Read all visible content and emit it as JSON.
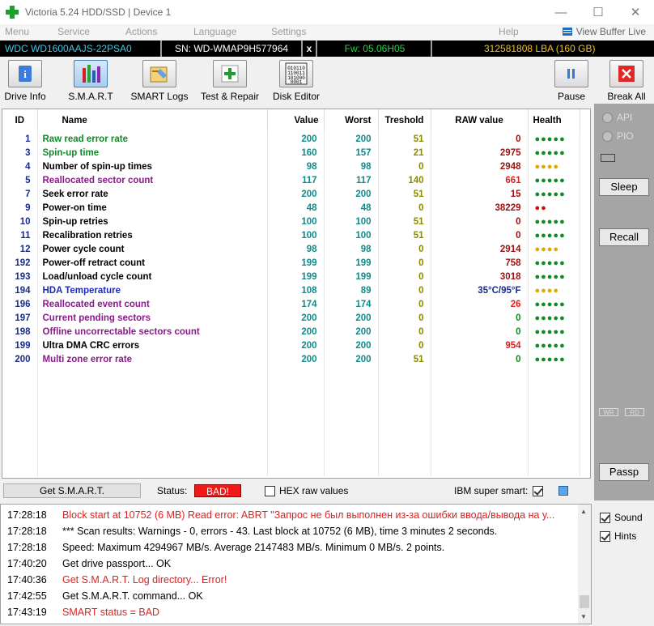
{
  "window": {
    "title": "Victoria 5.24 HDD/SSD | Device 1",
    "minimize": "—",
    "maximize": "☐",
    "close": "✕"
  },
  "menu": {
    "items": [
      "Menu",
      "Service",
      "Actions",
      "Language",
      "Settings",
      "Help"
    ],
    "view_buffer": "View Buffer Live"
  },
  "device": {
    "model": "WDC WD1600AAJS-22PSA0",
    "serial": "SN: WD-WMAP9H577964",
    "close_mark": "x",
    "firmware": "Fw: 05.06H05",
    "lba": "312581808 LBA (160 GB)"
  },
  "toolbar": {
    "drive_info": "Drive Info",
    "smart": "S.M.A.R.T",
    "smart_logs": "SMART Logs",
    "test_repair": "Test & Repair",
    "disk_editor": "Disk Editor",
    "pause": "Pause",
    "break_all": "Break All"
  },
  "table": {
    "headers": {
      "id": "ID",
      "name": "Name",
      "value": "Value",
      "worst": "Worst",
      "threshold": "Treshold",
      "raw": "RAW value",
      "health": "Health"
    },
    "rows": [
      {
        "id": "1",
        "name": "Raw read error rate",
        "value": "200",
        "worst": "200",
        "threshold": "51",
        "raw": "0",
        "health": "●●●●●",
        "name_color": "#0f8a25",
        "health_color": "#0f8a25",
        "raw_color": "#9b1010"
      },
      {
        "id": "3",
        "name": "Spin-up time",
        "value": "160",
        "worst": "157",
        "threshold": "21",
        "raw": "2975",
        "health": "●●●●●",
        "name_color": "#0f8a25",
        "health_color": "#0f8a25",
        "raw_color": "#9b1010"
      },
      {
        "id": "4",
        "name": "Number of spin-up times",
        "value": "98",
        "worst": "98",
        "threshold": "0",
        "raw": "2948",
        "health": "●●●●",
        "name_color": "#000000",
        "health_color": "#e0a800",
        "raw_color": "#9b1010"
      },
      {
        "id": "5",
        "name": "Reallocated sector count",
        "value": "117",
        "worst": "117",
        "threshold": "140",
        "raw": "661",
        "health": "●●●●●",
        "name_color": "#8b1a8b",
        "health_color": "#0f8a25",
        "raw_color": "#e02020"
      },
      {
        "id": "7",
        "name": "Seek error rate",
        "value": "200",
        "worst": "200",
        "threshold": "51",
        "raw": "15",
        "health": "●●●●●",
        "name_color": "#000000",
        "health_color": "#0f8a25",
        "raw_color": "#9b1010"
      },
      {
        "id": "9",
        "name": "Power-on time",
        "value": "48",
        "worst": "48",
        "threshold": "0",
        "raw": "38229",
        "health": "●●",
        "name_color": "#000000",
        "health_color": "#d01010",
        "raw_color": "#9b1010"
      },
      {
        "id": "10",
        "name": "Spin-up retries",
        "value": "100",
        "worst": "100",
        "threshold": "51",
        "raw": "0",
        "health": "●●●●●",
        "name_color": "#000000",
        "health_color": "#0f8a25",
        "raw_color": "#9b1010"
      },
      {
        "id": "11",
        "name": "Recalibration retries",
        "value": "100",
        "worst": "100",
        "threshold": "51",
        "raw": "0",
        "health": "●●●●●",
        "name_color": "#000000",
        "health_color": "#0f8a25",
        "raw_color": "#9b1010"
      },
      {
        "id": "12",
        "name": "Power cycle count",
        "value": "98",
        "worst": "98",
        "threshold": "0",
        "raw": "2914",
        "health": "●●●●",
        "name_color": "#000000",
        "health_color": "#e0a800",
        "raw_color": "#9b1010"
      },
      {
        "id": "192",
        "name": "Power-off retract count",
        "value": "199",
        "worst": "199",
        "threshold": "0",
        "raw": "758",
        "health": "●●●●●",
        "name_color": "#000000",
        "health_color": "#0f8a25",
        "raw_color": "#9b1010"
      },
      {
        "id": "193",
        "name": "Load/unload cycle count",
        "value": "199",
        "worst": "199",
        "threshold": "0",
        "raw": "3018",
        "health": "●●●●●",
        "name_color": "#000000",
        "health_color": "#0f8a25",
        "raw_color": "#9b1010"
      },
      {
        "id": "194",
        "name": "HDA Temperature",
        "value": "108",
        "worst": "89",
        "threshold": "0",
        "raw": "35°C/95°F",
        "health": "●●●●",
        "name_color": "#1a2bb8",
        "health_color": "#e0a800",
        "raw_color": "#1a2b8c"
      },
      {
        "id": "196",
        "name": "Reallocated event count",
        "value": "174",
        "worst": "174",
        "threshold": "0",
        "raw": "26",
        "health": "●●●●●",
        "name_color": "#8b1a8b",
        "health_color": "#0f8a25",
        "raw_color": "#e02020"
      },
      {
        "id": "197",
        "name": "Current pending sectors",
        "value": "200",
        "worst": "200",
        "threshold": "0",
        "raw": "0",
        "health": "●●●●●",
        "name_color": "#8b1a8b",
        "health_color": "#0f8a25",
        "raw_color": "#0f8a25"
      },
      {
        "id": "198",
        "name": "Offline uncorrectable sectors count",
        "value": "200",
        "worst": "200",
        "threshold": "0",
        "raw": "0",
        "health": "●●●●●",
        "name_color": "#8b1a8b",
        "health_color": "#0f8a25",
        "raw_color": "#0f8a25"
      },
      {
        "id": "199",
        "name": "Ultra DMA CRC errors",
        "value": "200",
        "worst": "200",
        "threshold": "0",
        "raw": "954",
        "health": "●●●●●",
        "name_color": "#000000",
        "health_color": "#0f8a25",
        "raw_color": "#e02020"
      },
      {
        "id": "200",
        "name": "Multi zone error rate",
        "value": "200",
        "worst": "200",
        "threshold": "51",
        "raw": "0",
        "health": "●●●●●",
        "name_color": "#8b1a8b",
        "health_color": "#0f8a25",
        "raw_color": "#0f8a25"
      }
    ]
  },
  "status": {
    "get_smart": "Get S.M.A.R.T.",
    "status_label": "Status:",
    "status_value": "BAD!",
    "hex_raw": "HEX raw values",
    "ibm_super_smart": "IBM super smart:"
  },
  "side": {
    "api": "API",
    "pio": "PIO",
    "sleep": "Sleep",
    "recall": "Recall",
    "wr": "WR",
    "rd": "RD",
    "passp": "Passp",
    "sound": "Sound",
    "hints": "Hints"
  },
  "log": [
    {
      "time": "17:28:18",
      "text": "Block start at 10752 (6 MB) Read error: ABRT \"Запрос не был выполнен из-за ошибки ввода/вывода на у...",
      "color": "#e02020"
    },
    {
      "time": "17:28:18",
      "text": "*** Scan results: Warnings - 0, errors - 43. Last block at 10752 (6 MB), time 3 minutes 2 seconds.",
      "color": "#000000"
    },
    {
      "time": "17:28:18",
      "text": "Speed: Maximum 4294967 MB/s. Average 2147483 MB/s. Minimum 0 MB/s. 2 points.",
      "color": "#000000"
    },
    {
      "time": "17:40:20",
      "text": "Get drive passport... OK",
      "color": "#000000"
    },
    {
      "time": "17:40:36",
      "text": "Get S.M.A.R.T. Log directory... Error!",
      "color": "#e02020"
    },
    {
      "time": "17:42:55",
      "text": "Get S.M.A.R.T. command... OK",
      "color": "#000000"
    },
    {
      "time": "17:43:19",
      "text": "SMART status = BAD",
      "color": "#e02020"
    }
  ]
}
